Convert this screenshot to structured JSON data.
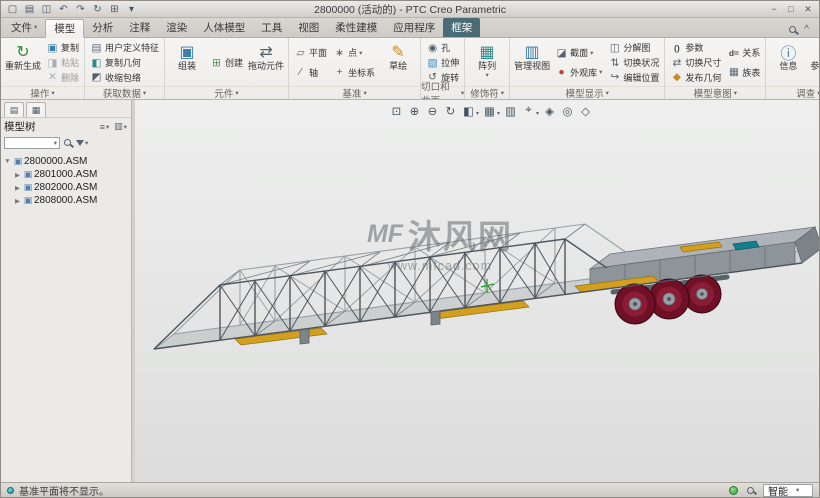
{
  "window": {
    "title": "2800000 (活动的) - PTC Creo Parametric"
  },
  "quick_access": {
    "icons": [
      "new-file-icon",
      "open-icon",
      "save-icon",
      "undo-icon",
      "redo-icon",
      "regenerate-icon",
      "windows-icon",
      "customize-arrow-icon"
    ]
  },
  "window_controls": {
    "icons": [
      "minimize-icon",
      "maximize-icon",
      "close-icon"
    ]
  },
  "menu_tabs": {
    "active": "模型",
    "items": [
      {
        "label": "文件"
      },
      {
        "label": "模型"
      },
      {
        "label": "分析"
      },
      {
        "label": "注释"
      },
      {
        "label": "渲染"
      },
      {
        "label": "人体模型"
      },
      {
        "label": "工具"
      },
      {
        "label": "视图"
      },
      {
        "label": "柔性建模"
      },
      {
        "label": "应用程序"
      },
      {
        "label": "框架"
      }
    ]
  },
  "ribbon": {
    "groups": [
      {
        "label": "操作",
        "buttons": [
          {
            "label": "重新生成",
            "icon": "regenerate-icon"
          },
          {
            "label": "复制",
            "icon": "copy-icon"
          },
          {
            "label": "粘贴",
            "icon": "paste-icon"
          },
          {
            "label": "删除",
            "icon": "delete-icon"
          }
        ]
      },
      {
        "label": "获取数据",
        "buttons": [
          {
            "label": "用户定义特征",
            "icon": "udf-icon"
          },
          {
            "label": "复制几何",
            "icon": "copy-geometry-icon"
          },
          {
            "label": "收缩包络",
            "icon": "shrinkwrap-icon"
          }
        ]
      },
      {
        "label": "元件",
        "buttons": [
          {
            "label": "组装",
            "icon": "assemble-icon"
          },
          {
            "label": "创建",
            "icon": "create-component-icon"
          },
          {
            "label": "拖动元件",
            "icon": "drag-component-icon"
          }
        ]
      },
      {
        "label": "基准",
        "buttons": [
          {
            "label": "平面",
            "icon": "datum-plane-icon"
          },
          {
            "label": "轴",
            "icon": "datum-axis-icon"
          },
          {
            "label": "点",
            "icon": "datum-point-icon"
          },
          {
            "label": "坐标系",
            "icon": "csys-icon"
          },
          {
            "label": "草绘",
            "icon": "sketch-icon"
          }
        ]
      },
      {
        "label": "切口和曲面",
        "buttons": [
          {
            "label": "孔",
            "icon": "hole-icon"
          },
          {
            "label": "拉伸",
            "icon": "extrude-icon"
          },
          {
            "label": "旋转",
            "icon": "revolve-icon"
          }
        ]
      },
      {
        "label": "修饰符",
        "buttons": [
          {
            "label": "阵列",
            "icon": "pattern-icon"
          }
        ]
      },
      {
        "label": "模型显示",
        "buttons": [
          {
            "label": "管理视图",
            "icon": "manage-views-icon"
          },
          {
            "label": "截面",
            "icon": "section-icon"
          },
          {
            "label": "外观库",
            "icon": "appearance-gallery-icon"
          },
          {
            "label": "分解图",
            "icon": "exploded-view-icon"
          },
          {
            "label": "切换状况",
            "icon": "toggle-status-icon"
          },
          {
            "label": "编辑位置",
            "icon": "edit-position-icon"
          }
        ]
      },
      {
        "label": "模型意图",
        "buttons": [
          {
            "label": "参数",
            "icon": "parameters-icon"
          },
          {
            "label": "切换尺寸",
            "icon": "switch-dimensions-icon"
          },
          {
            "label": "发布几何",
            "icon": "publish-geometry-icon"
          },
          {
            "label": "关系",
            "icon": "relations-icon"
          },
          {
            "label": "族表",
            "icon": "family-table-icon"
          }
        ]
      },
      {
        "label": "调查",
        "buttons": [
          {
            "label": "信息",
            "icon": "info-icon"
          },
          {
            "label": "参考查看器",
            "icon": "reference-viewer-icon"
          }
        ]
      }
    ]
  },
  "graphics_toolbar": {
    "icons": [
      "refit-icon",
      "zoom-in-icon",
      "zoom-out-icon",
      "repaint-icon",
      "display-style-icon",
      "saved-orientations-icon",
      "view-manager-icon",
      "datum-display-icon",
      "annotation-display-icon",
      "spin-center-icon",
      "perspective-icon"
    ]
  },
  "model_tree": {
    "title": "模型树",
    "tabs": [
      "tree-tab-icon",
      "folder-tab-icon"
    ],
    "filter_value": "",
    "items": [
      {
        "label": "2800000.ASM"
      },
      {
        "label": "2801000.ASM"
      },
      {
        "label": "2802000.ASM"
      },
      {
        "label": "2808000.ASM"
      }
    ]
  },
  "viewport": {
    "watermark": {
      "logo": "MF",
      "name": "沐风网",
      "url": "www.mfcad.com"
    }
  },
  "status_bar": {
    "message": "基准平面将不显示。",
    "icons": [
      "regeneration-status-icon",
      "find-icon"
    ],
    "selection_filter": {
      "label": "智能"
    }
  },
  "colors": {
    "frame_gray": "#4d555d",
    "wheel_maroon": "#701026",
    "part_yellow": "#d2a01e",
    "part_teal": "#11808c",
    "tab_special": "#4a6b75"
  }
}
